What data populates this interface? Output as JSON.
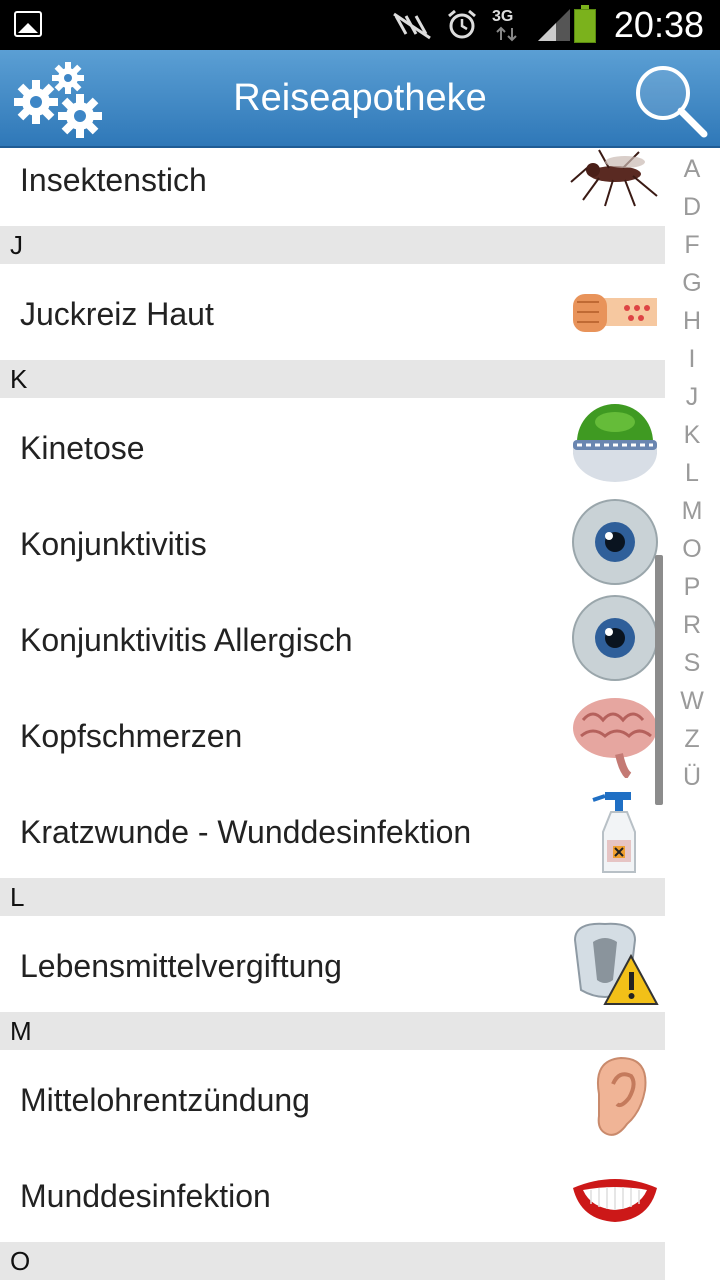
{
  "status": {
    "time": "20:38",
    "network": "3G"
  },
  "app": {
    "title": "Reiseapotheke"
  },
  "items": [
    {
      "type": "row",
      "label": "Insektenstich",
      "icon": "mosquito-icon"
    },
    {
      "type": "header",
      "label": "J"
    },
    {
      "type": "row",
      "label": "Juckreiz Haut",
      "icon": "itchy-arm-icon"
    },
    {
      "type": "header",
      "label": "K"
    },
    {
      "type": "row",
      "label": "Kinetose",
      "icon": "motion-sickness-icon"
    },
    {
      "type": "row",
      "label": "Konjunktivitis",
      "icon": "eye-icon"
    },
    {
      "type": "row",
      "label": "Konjunktivitis Allergisch",
      "icon": "eye-icon"
    },
    {
      "type": "row",
      "label": "Kopfschmerzen",
      "icon": "brain-icon"
    },
    {
      "type": "row",
      "label": "Kratzwunde - Wunddesinfektion",
      "icon": "spray-bottle-icon"
    },
    {
      "type": "header",
      "label": "L"
    },
    {
      "type": "row",
      "label": "Lebensmittelvergiftung",
      "icon": "toilet-warning-icon"
    },
    {
      "type": "header",
      "label": "M"
    },
    {
      "type": "row",
      "label": "Mittelohrentzündung",
      "icon": "ear-icon"
    },
    {
      "type": "row",
      "label": "Munddesinfektion",
      "icon": "mouth-icon"
    },
    {
      "type": "header",
      "label": "O"
    }
  ],
  "index_letters": [
    "A",
    "D",
    "F",
    "G",
    "H",
    "I",
    "J",
    "K",
    "L",
    "M",
    "O",
    "P",
    "R",
    "S",
    "W",
    "Z",
    "Ü"
  ]
}
